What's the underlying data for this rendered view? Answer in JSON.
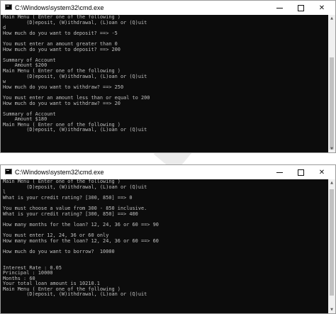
{
  "windows": [
    {
      "title": "C:\\Windows\\system32\\cmd.exe",
      "lines": [
        "Main Menu ( Enter one of the following )",
        "        (D)eposit, (W)ithdrawal, (L)oan or (Q)uit",
        "d",
        "How much do you want to deposit? ==> -5",
        "",
        "You must enter an amount greater than 0",
        "How much do you want to deposit? ==> 200",
        "",
        "Summary of Account",
        "    Amount $200",
        "Main Menu ( Enter one of the following )",
        "        (D)eposit, (W)ithdrawal, (L)oan or (Q)uit",
        "w",
        "How much do you want to withdraw? ==> 250",
        "",
        "You must enter an amount less than or equal to 200",
        "How much do you want to withdraw? ==> 20",
        "",
        "Summary of Account",
        "    Amount $180",
        "Main Menu ( Enter one of the following )",
        "        (D)eposit, (W)ithdrawal, (L)oan or (Q)uit"
      ]
    },
    {
      "title": "C:\\Windows\\system32\\cmd.exe",
      "lines": [
        "Main Menu ( Enter one of the following )",
        "        (D)eposit, (W)ithdrawal, (L)oan or (Q)uit",
        "l",
        "What is your credit rating? [300, 850] ==> 0",
        "",
        "You must choose a value from 300 - 850 inclusive.",
        "What is your credit rating? [300, 850] ==> 400",
        "",
        "How many months for the loan? 12, 24, 36 or 60 ==> 90",
        "",
        "You must enter 12, 24, 36 or 60 only",
        "How many months for the loan? 12, 24, 36 or 60 ==> 60",
        "",
        "How much do you want to borrow?  10000",
        "",
        "",
        "Interest Rate : 0.05",
        "Principal : 10000",
        "Months : 60",
        "Your total loan amount is 10210.1",
        "Main Menu ( Enter one of the following )",
        "        (D)eposit, (W)ithdrawal, (L)oan or (Q)uit"
      ]
    }
  ],
  "controls": {
    "minimize_icon": "minimize-icon",
    "maximize_icon": "maximize-icon",
    "close_glyph": "✕"
  },
  "colors": {
    "console_bg": "#0c0c0c",
    "console_text": "#c0c0c0",
    "titlebar_bg": "#ffffff"
  }
}
